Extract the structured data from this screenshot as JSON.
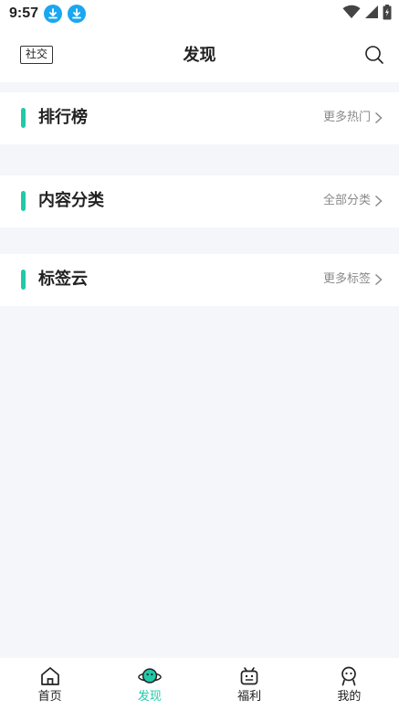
{
  "status_bar": {
    "time": "9:57"
  },
  "header": {
    "social_label": "社交",
    "title": "发现"
  },
  "sections": [
    {
      "title": "排行榜",
      "more": "更多热门"
    },
    {
      "title": "内容分类",
      "more": "全部分类"
    },
    {
      "title": "标签云",
      "more": "更多标签"
    }
  ],
  "tabs": [
    {
      "label": "首页",
      "icon": "home-icon"
    },
    {
      "label": "发现",
      "icon": "planet-icon",
      "active": true
    },
    {
      "label": "福利",
      "icon": "gift-robot-icon"
    },
    {
      "label": "我的",
      "icon": "person-icon"
    }
  ],
  "colors": {
    "accent": "#21c9a9",
    "download_badge": "#1aa7f0",
    "background": "#f5f6fa"
  }
}
